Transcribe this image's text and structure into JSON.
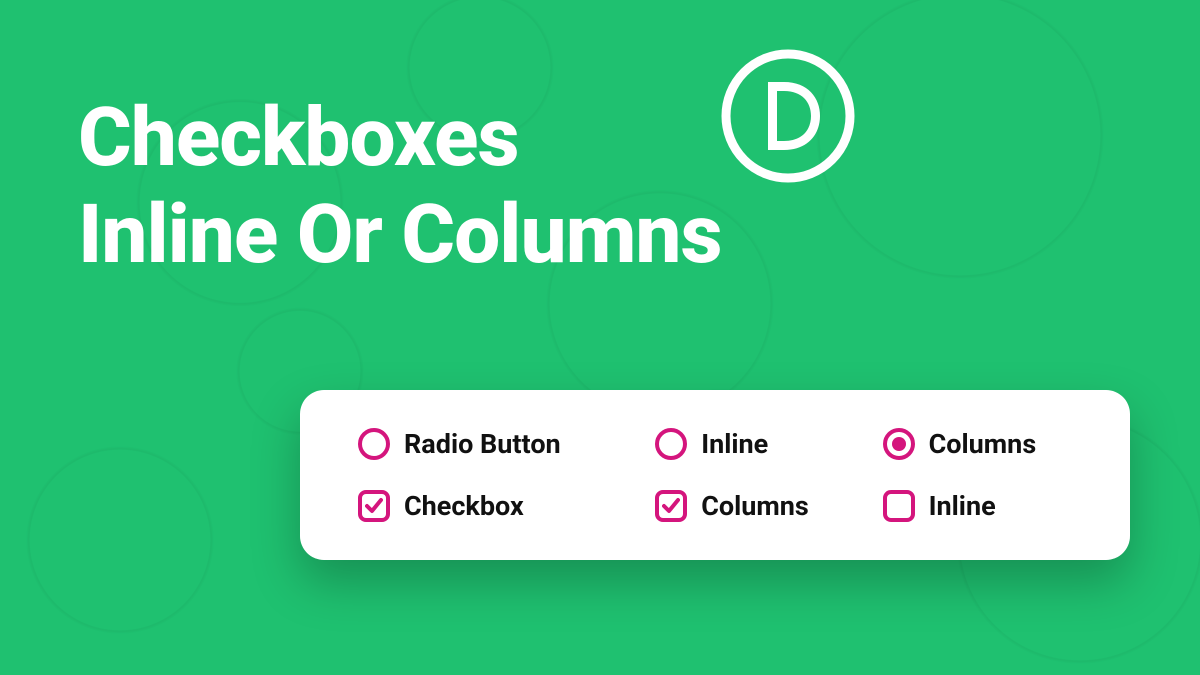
{
  "headline": {
    "line1": "Checkboxes",
    "line2": "Inline Or Columns"
  },
  "logo_letter": "D",
  "accent_color": "#d4157d",
  "card": {
    "radios": [
      {
        "label": "Radio Button",
        "selected": false
      },
      {
        "label": "Inline",
        "selected": false
      },
      {
        "label": "Columns",
        "selected": true
      }
    ],
    "checkboxes": [
      {
        "label": "Checkbox",
        "checked": true
      },
      {
        "label": "Columns",
        "checked": true
      },
      {
        "label": "Inline",
        "checked": false
      }
    ]
  }
}
